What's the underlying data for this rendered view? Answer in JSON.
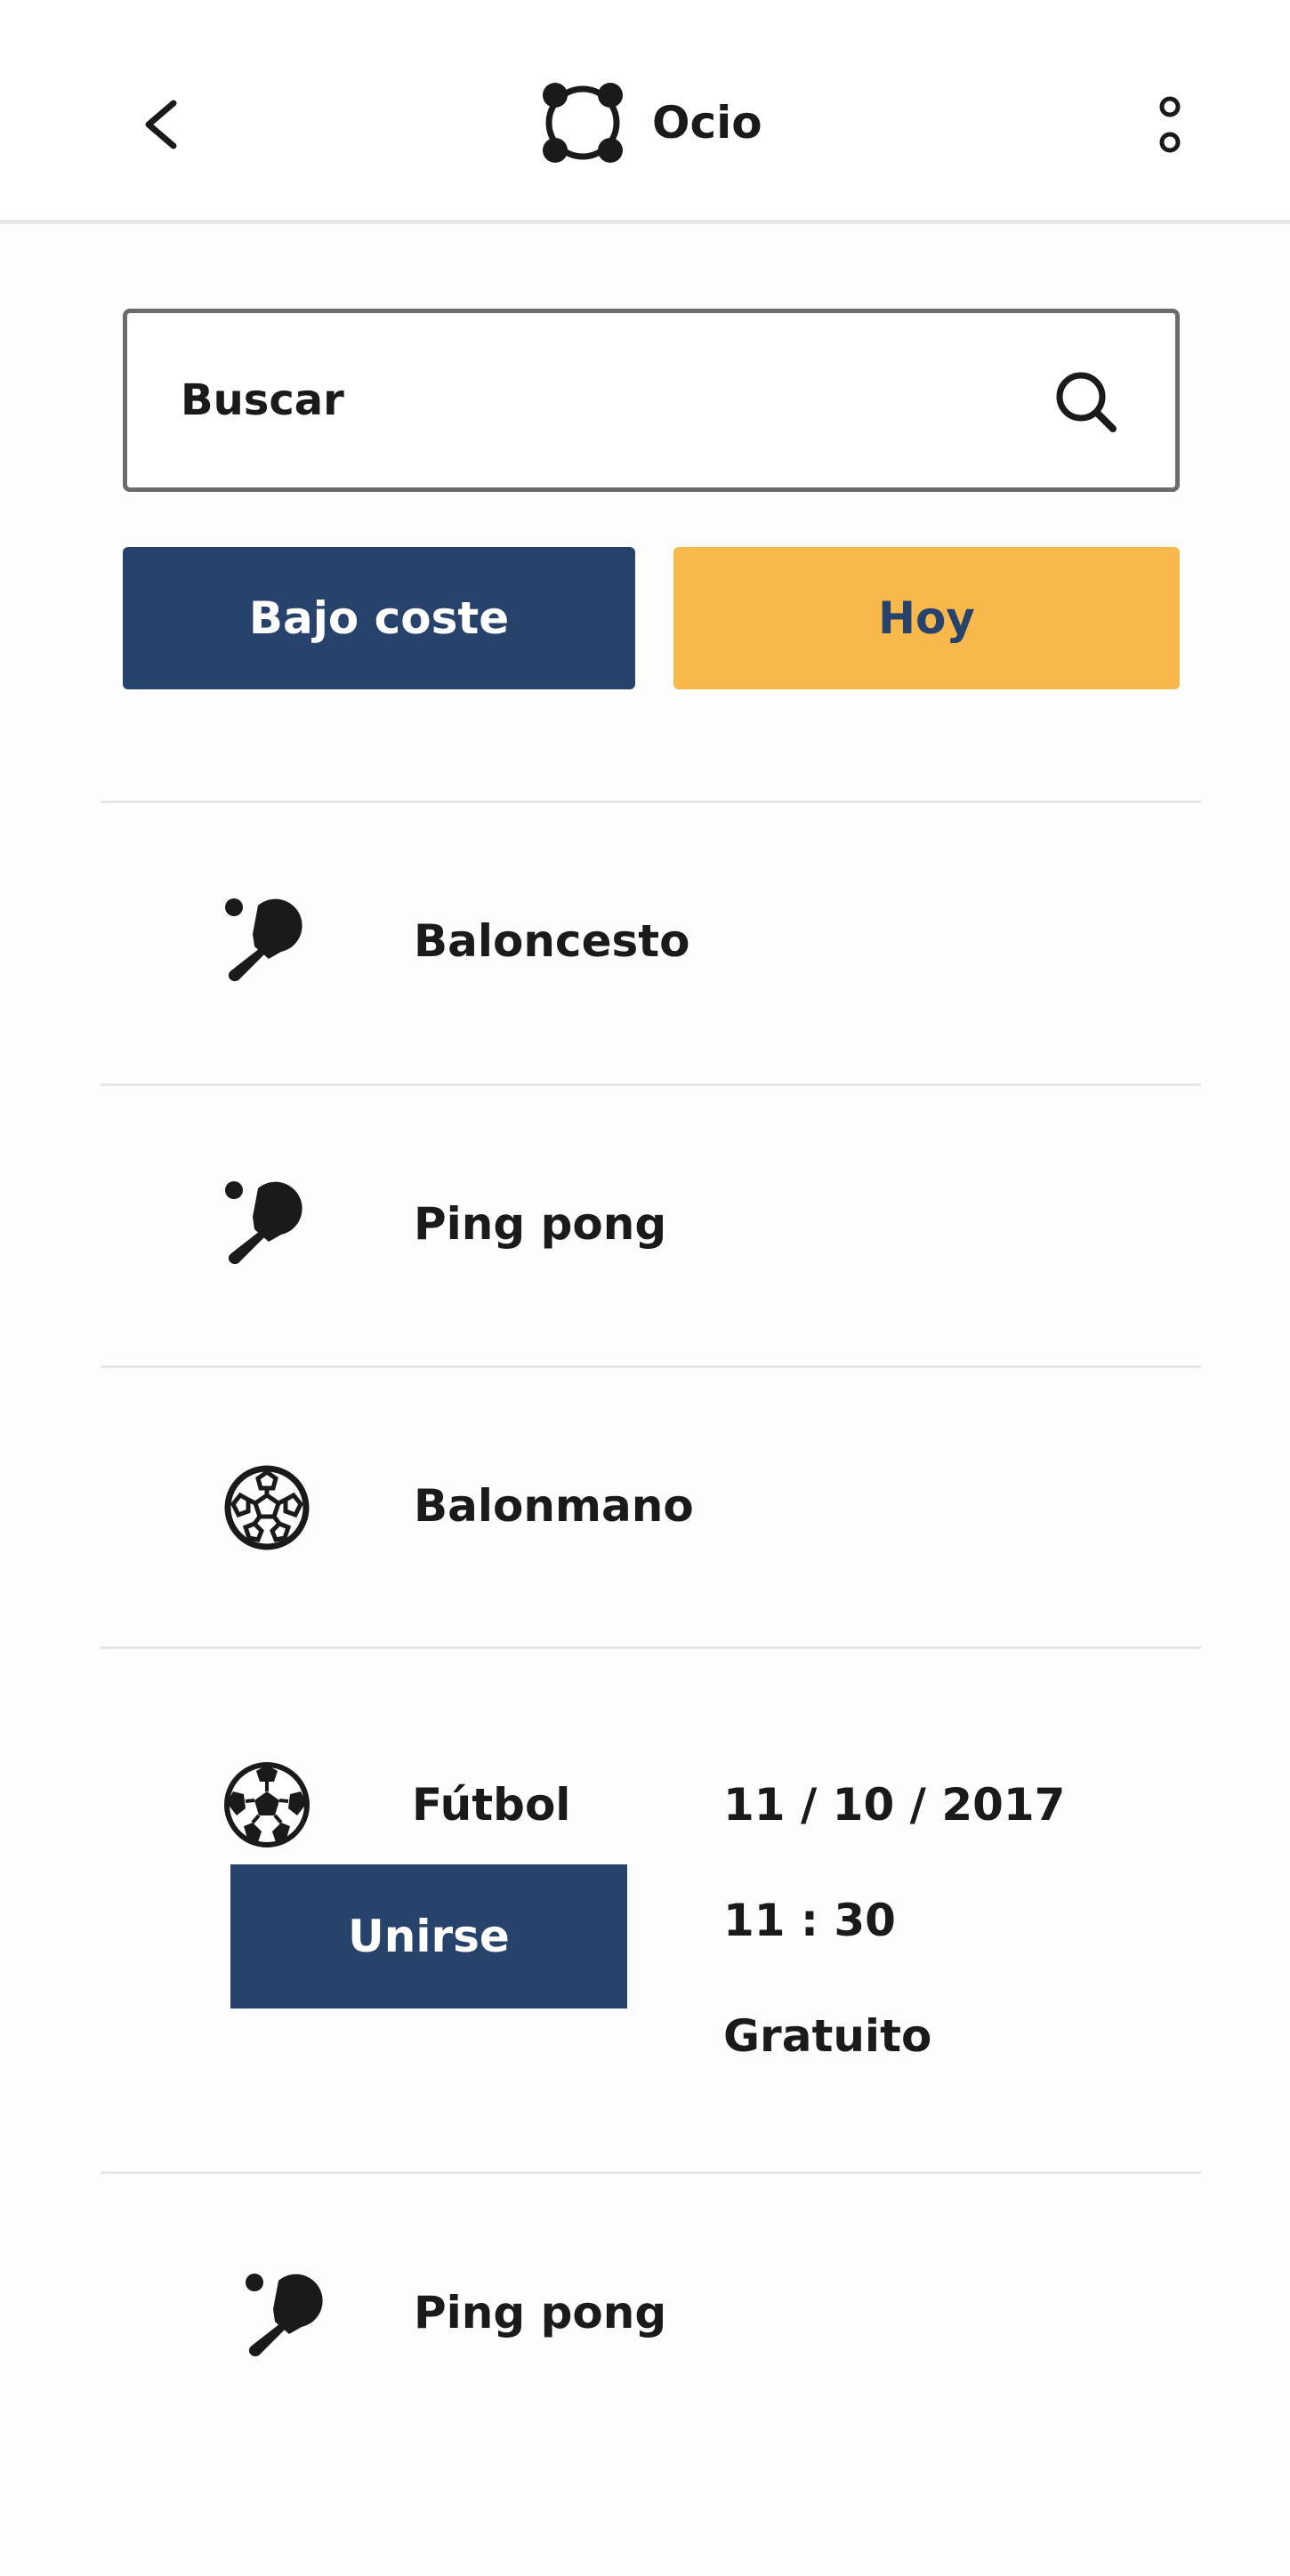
{
  "header": {
    "title": "Ocio",
    "back_icon": "chevron-left-icon",
    "logo_icon": "circle-nodes-logo-icon",
    "menu_icon": "more-vertical-icon"
  },
  "search": {
    "placeholder": "Buscar",
    "value": "",
    "icon": "search-icon"
  },
  "filters": {
    "low_cost_label": "Bajo coste",
    "today_label": "Hoy"
  },
  "colors": {
    "primary": "#27426b",
    "accent": "#f8b84c",
    "text": "#1a1a1a",
    "divider": "#e6e6e6"
  },
  "activities": [
    {
      "name": "Baloncesto",
      "icon": "ping-pong-paddle-icon"
    },
    {
      "name": "Ping pong",
      "icon": "ping-pong-paddle-icon"
    },
    {
      "name": "Balonmano",
      "icon": "handball-icon"
    },
    {
      "name": "Fútbol",
      "icon": "soccer-ball-icon",
      "expanded": true,
      "date": "11 / 10 / 2017",
      "time": "11 : 30",
      "price": "Gratuito",
      "join_label": "Unirse"
    },
    {
      "name": "Ping pong",
      "icon": "ping-pong-paddle-icon"
    }
  ]
}
